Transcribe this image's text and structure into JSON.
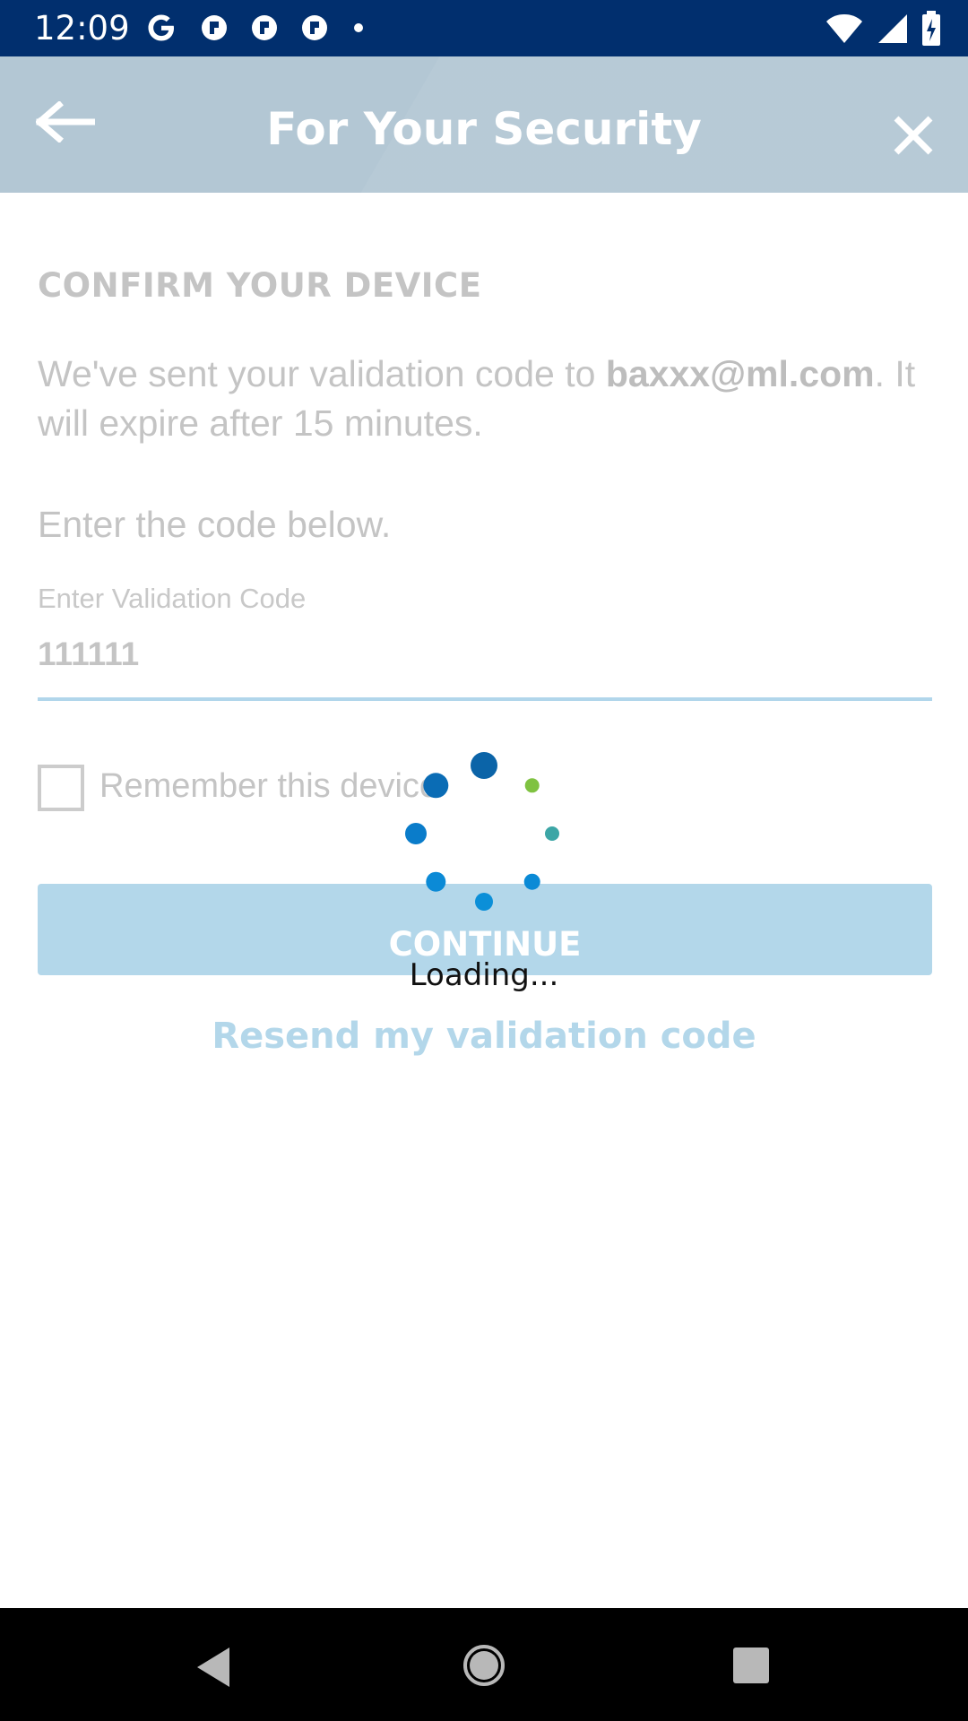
{
  "status_bar": {
    "time": "12:09",
    "left_icons": [
      "google-icon",
      "notification-icon",
      "notification-icon",
      "notification-icon",
      "dot-icon"
    ],
    "right_icons": [
      "wifi-icon",
      "cell-signal-icon",
      "battery-charging-icon"
    ]
  },
  "header": {
    "title": "For Your Security",
    "back_icon": "arrow-left-icon",
    "close_icon": "close-icon"
  },
  "content": {
    "section_heading": "CONFIRM YOUR DEVICE",
    "info_prefix": "We've sent your validation code to ",
    "email": "baxxx@ml.com",
    "info_suffix": ". It will expire after 15 minutes.",
    "enter_below": "Enter the code below.",
    "field_label": "Enter Validation Code",
    "field_value": "111111",
    "remember_label": "Remember this device",
    "remember_checked": false,
    "continue_label": "CONTINUE",
    "resend_label": "Resend my validation code"
  },
  "overlay": {
    "loading_text": "Loading...",
    "spinner_colors": [
      "#0b64a8",
      "#7fc241",
      "#3ca6a6",
      "#0a8ad6",
      "#0b8fd8",
      "#0b8ad6",
      "#0a7cca",
      "#0a6cb5"
    ]
  },
  "nav_bar": {
    "icons": [
      "nav-back-icon",
      "nav-home-icon",
      "nav-recents-icon"
    ]
  },
  "colors": {
    "status_bar": "#012f6e",
    "header": "#b3c7d4",
    "button": "#b3d7ea"
  }
}
